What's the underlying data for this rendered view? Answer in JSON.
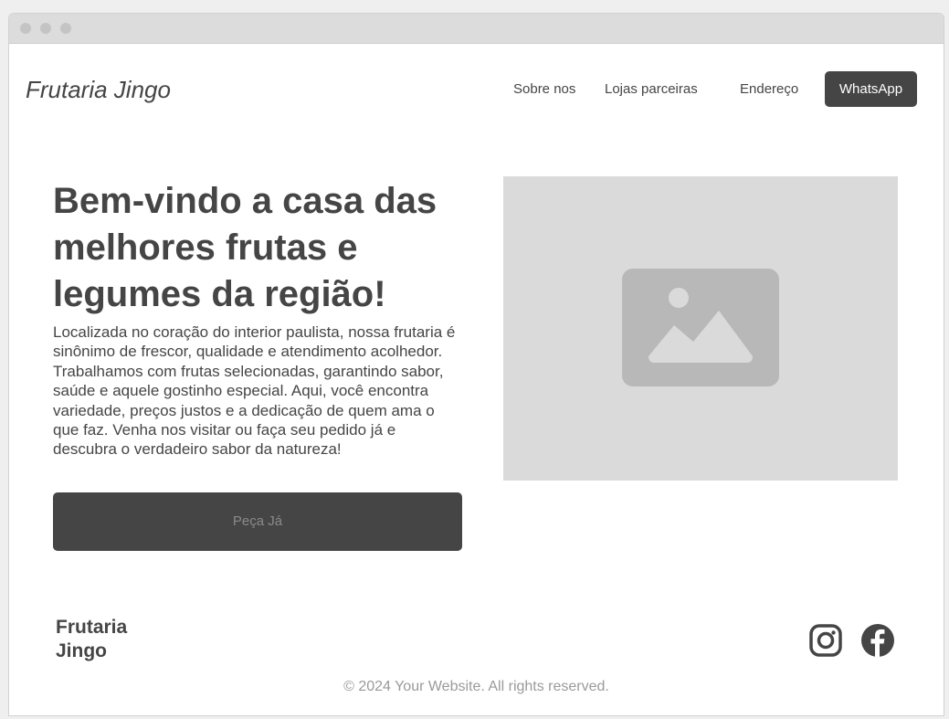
{
  "header": {
    "brand": "Frutaria Jingo",
    "nav": [
      {
        "label": "Sobre nos"
      },
      {
        "label": "Lojas parceiras"
      },
      {
        "label": "Endereço"
      }
    ],
    "whatsapp_label": "WhatsApp"
  },
  "hero": {
    "title": "Bem-vindo a casa das melhores frutas e legumes da região!",
    "description": "Localizada no coração do interior paulista, nossa frutaria é sinônimo de frescor, qualidade e atendimento acolhedor. Trabalhamos com frutas selecionadas, garantindo sabor, saúde e aquele gostinho especial. Aqui, você encontra variedade, preços justos e a dedicação de quem ama o que faz. Venha nos visitar ou faça seu pedido já e descubra o verdadeiro sabor da natureza!",
    "cta_label": "Peça Já",
    "image_icon": "image-placeholder-icon"
  },
  "footer": {
    "brand_line1": "Frutaria",
    "brand_line2": "Jingo",
    "social": [
      {
        "icon": "instagram-icon"
      },
      {
        "icon": "facebook-icon"
      }
    ],
    "copyright": "© 2024 Your Website. All rights reserved."
  },
  "colors": {
    "primary": "#454545",
    "placeholder_bg": "#dadada",
    "placeholder_icon": "#b8b8b8",
    "muted_text": "#9a9a9a",
    "titlebar": "#dcdcdc"
  }
}
